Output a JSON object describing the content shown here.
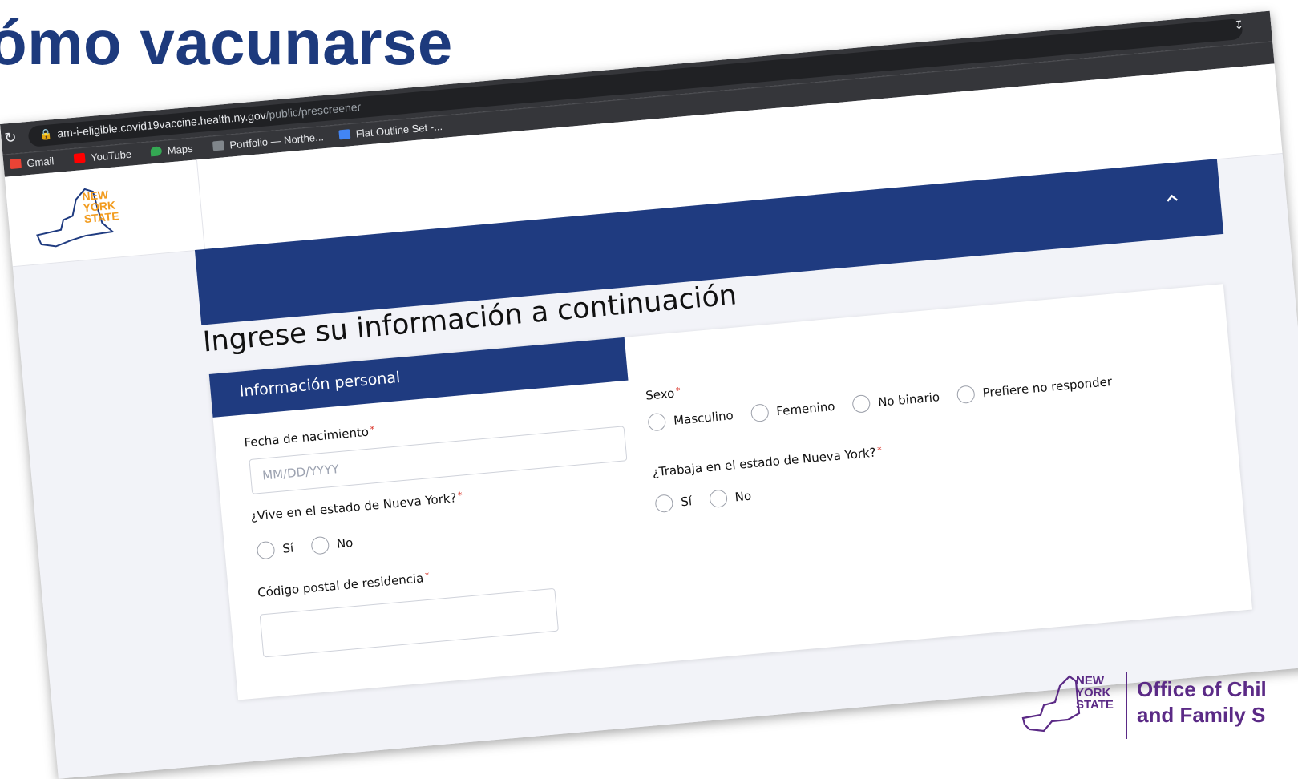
{
  "slide": {
    "title": "ómo vacunarse"
  },
  "browser": {
    "url_host": "am-i-eligible.covid19vaccine.health.ny.gov",
    "url_path": "/public/prescreener",
    "bookmarks": [
      "Gmail",
      "YouTube",
      "Maps",
      "Portfolio — Northe...",
      "Flat Outline Set -..."
    ]
  },
  "header": {
    "logo_text": [
      "NEW",
      "YORK",
      "STATE"
    ]
  },
  "form": {
    "heading": "Ingrese su información a continuación",
    "card_title": "Información personal",
    "birthdate": {
      "label": "Fecha de nacimiento",
      "placeholder": "MM/DD/YYYY",
      "value": ""
    },
    "lives_ny": {
      "label": "¿Vive en el estado de Nueva York?",
      "options": [
        "Sí",
        "No"
      ]
    },
    "zip": {
      "label": "Código postal de residencia",
      "value": ""
    },
    "sex": {
      "label": "Sexo",
      "options": [
        "Masculino",
        "Femenino",
        "No binario",
        "Prefiere no responder"
      ]
    },
    "works_ny": {
      "label": "¿Trabaja en el estado de Nueva York?",
      "options": [
        "Sí",
        "No"
      ]
    },
    "required_mark": "*"
  },
  "footer": {
    "nys": [
      "NEW",
      "YORK",
      "STATE"
    ],
    "office_line1": "Office of Chil",
    "office_line2": "and Family S"
  },
  "colors": {
    "title": "#1d3a7d",
    "banner": "#1f3b80",
    "footer": "#5b2a86",
    "required": "#d93025"
  }
}
